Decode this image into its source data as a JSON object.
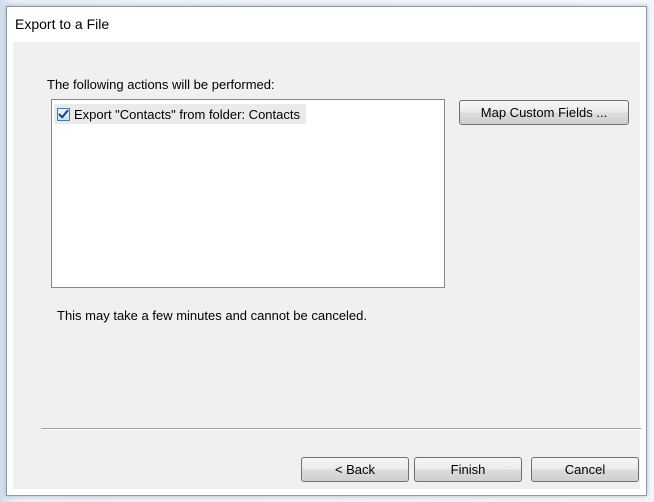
{
  "window": {
    "title": "Export to a File"
  },
  "content": {
    "heading": "The following actions will be performed:",
    "actions": [
      {
        "label": "Export \"Contacts\" from folder: Contacts",
        "checked": true
      }
    ],
    "note": "This may take a few minutes and cannot be canceled."
  },
  "buttons": {
    "map_custom_fields": "Map Custom Fields ...",
    "back": "< Back",
    "finish": "Finish",
    "cancel": "Cancel"
  },
  "colors": {
    "dialog_background": "#f0f0f0",
    "checkbox_check": "#1a3d8f"
  },
  "icons": {
    "check": "checkmark-icon"
  }
}
